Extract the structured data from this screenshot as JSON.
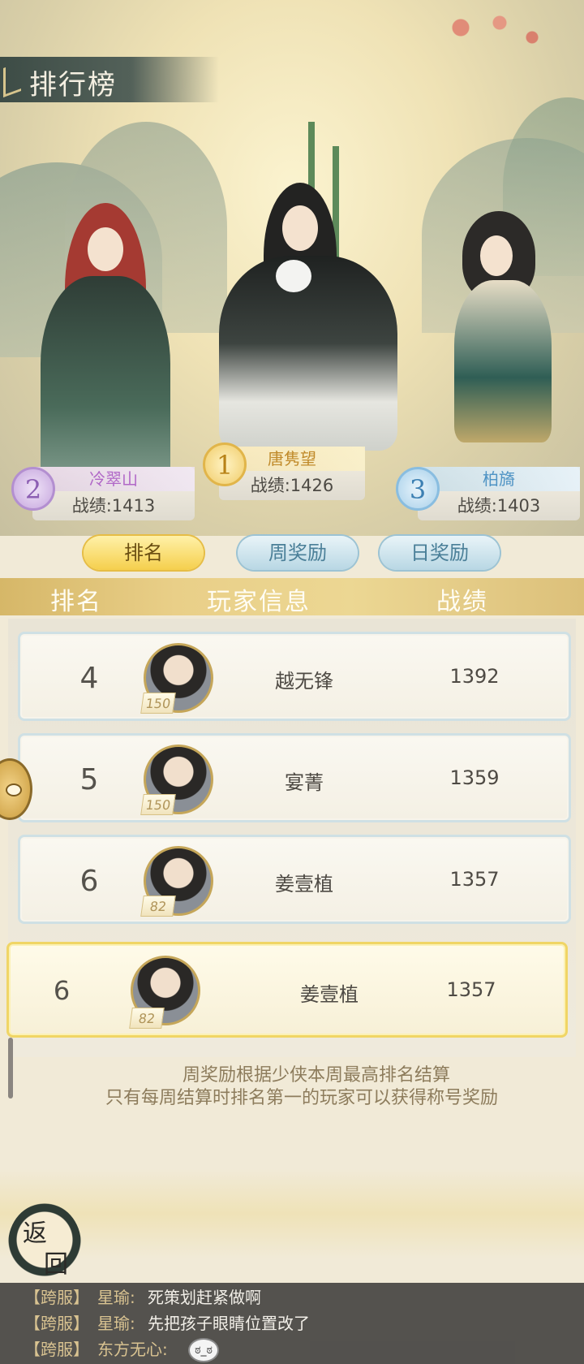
{
  "header": {
    "title": "排行榜"
  },
  "podium": [
    {
      "rank": "2",
      "name": "冷翠山",
      "score": "战绩:1413"
    },
    {
      "rank": "1",
      "name": "唐隽望",
      "score": "战绩:1426"
    },
    {
      "rank": "3",
      "name": "柏旖",
      "score": "战绩:1403"
    }
  ],
  "tabs": [
    {
      "label": "排名",
      "active": true
    },
    {
      "label": "周奖励",
      "active": false
    },
    {
      "label": "日奖励",
      "active": false
    }
  ],
  "columns": {
    "rank": "排名",
    "info": "玩家信息",
    "score": "战绩"
  },
  "rows": [
    {
      "rank": "4",
      "level": "150",
      "name": "越无锋",
      "score": "1392"
    },
    {
      "rank": "5",
      "level": "150",
      "name": "宴菁",
      "score": "1359"
    },
    {
      "rank": "6",
      "level": "82",
      "name": "姜壹植",
      "score": "1357"
    }
  ],
  "my_row": {
    "rank": "6",
    "level": "82",
    "name": "姜壹植",
    "score": "1357"
  },
  "notes": [
    "周奖励根据少侠本周最高排名结算",
    "只有每周结算时排名第一的玩家可以获得称号奖励"
  ],
  "back_button": {
    "line1": "返",
    "line2": "回"
  },
  "chat": [
    {
      "channel": "【跨服】",
      "sender": "星瑜:",
      "message": "死策划赶紧做啊"
    },
    {
      "channel": "【跨服】",
      "sender": "星瑜:",
      "message": "先把孩子眼睛位置改了"
    },
    {
      "channel": "【跨服】",
      "sender": "东方无心:",
      "message": ""
    }
  ],
  "icons": {
    "emoji": "emoji-face-icon",
    "side_button": "chat-bubble-icon",
    "title_decoration": "banner-decoration-icon"
  },
  "colors": {
    "gold": "#e6bd45",
    "silver_purple": "#b067c7",
    "bronze_blue": "#4e93c4",
    "header_bar": "#e9cf88"
  }
}
